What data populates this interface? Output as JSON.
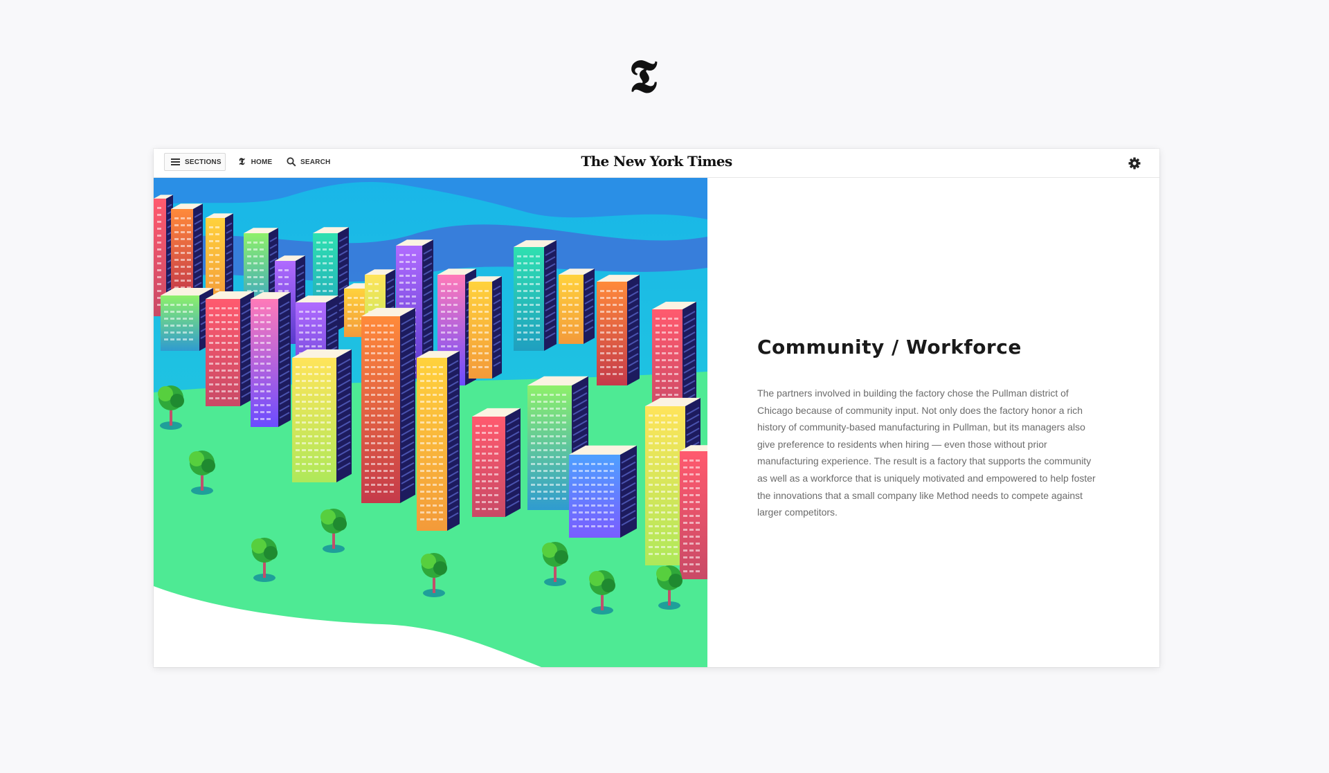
{
  "brand": {
    "logo_glyph": "𝕿",
    "masthead": "The New York Times"
  },
  "topbar": {
    "sections_label": "SECTIONS",
    "home_label": "HOME",
    "home_glyph": "𝕿",
    "search_label": "SEARCH"
  },
  "article": {
    "heading": "Community / Workforce",
    "body": "The partners involved in building the factory chose the Pullman district of Chicago because of community input. Not only does the factory honor a rich history of community-based manufacturing in Pullman, but its managers also give preference to residents when hiring — even those without prior manufacturing experience. The result is a factory that supports the community as well as a workforce that is uniquely motivated and empowered to help foster the innovations that a small company like Method needs to compete against larger competitors."
  },
  "colors": {
    "sky": "#22c9df",
    "grass": "#4eea94",
    "building_shadow": "#1d1b5e"
  }
}
